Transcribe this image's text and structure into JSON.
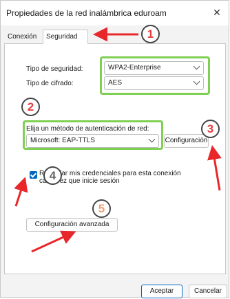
{
  "window": {
    "title": "Propiedades de la red inalámbrica eduroam",
    "close_glyph": "✕"
  },
  "tabs": [
    {
      "label": "Conexión",
      "active": false
    },
    {
      "label": "Seguridad",
      "active": true
    }
  ],
  "security": {
    "security_type_label": "Tipo de seguridad:",
    "security_type_value": "WPA2-Enterprise",
    "encryption_type_label": "Tipo de cifrado:",
    "encryption_type_value": "AES",
    "auth_method_label": "Elija un método de autenticación de red:",
    "auth_method_value": "Microsoft: EAP-TTLS",
    "configuration_button": "Configuración",
    "remember_credentials_label": "Recordar mis credenciales para esta conexión cada vez que inicie sesión",
    "remember_credentials_checked": true,
    "advanced_settings_button": "Configuración avanzada"
  },
  "footer": {
    "accept_button": "Aceptar",
    "cancel_button": "Cancelar"
  },
  "annotations": {
    "step_numbers": [
      "1",
      "2",
      "3",
      "4",
      "5"
    ],
    "arrow_color": "#e8272a",
    "highlight_color": "#7fcf52"
  }
}
